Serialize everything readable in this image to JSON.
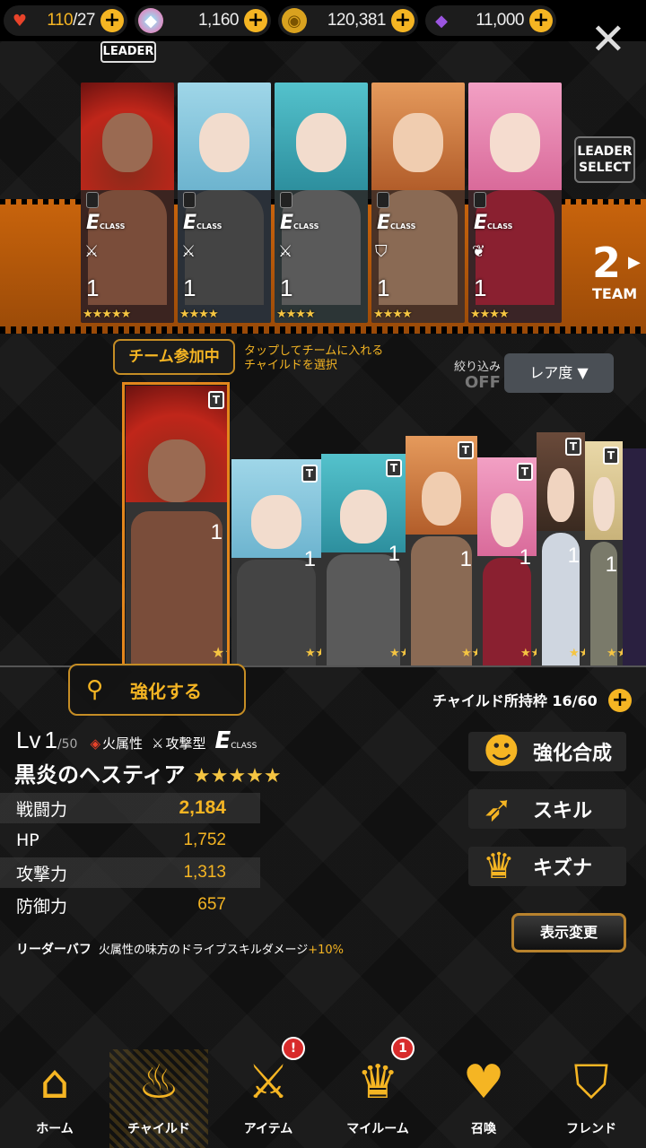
{
  "resources": [
    {
      "icon": "heart-icon",
      "value_hl": "110",
      "value": "/27"
    },
    {
      "icon": "crystal-icon",
      "value_hl": "",
      "value": "1,160"
    },
    {
      "icon": "coin-icon",
      "value_hl": "",
      "value": "120,381"
    },
    {
      "icon": "gem-icon",
      "value_hl": "",
      "value": "11,000"
    }
  ],
  "team": {
    "leader_tag": "LEADER",
    "leader_select": "LEADER SELECT",
    "number": "2",
    "label": "TEAM",
    "members": [
      {
        "class": "E",
        "class_sub": "CLASS",
        "level": "1",
        "stars": "★★★★★"
      },
      {
        "class": "E",
        "class_sub": "CLASS",
        "level": "1",
        "stars": "★★★★"
      },
      {
        "class": "E",
        "class_sub": "CLASS",
        "level": "1",
        "stars": "★★★★"
      },
      {
        "class": "E",
        "class_sub": "CLASS",
        "level": "1",
        "stars": "★★★★"
      },
      {
        "class": "E",
        "class_sub": "CLASS",
        "level": "1",
        "stars": "★★★★"
      }
    ]
  },
  "joined_label": "チーム参加中",
  "hint": [
    "タップしてチームに入れる",
    "チャイルドを選択"
  ],
  "filter": {
    "label": "絞り込み",
    "value": "OFF",
    "sort": "レア度 ▼"
  },
  "roster": [
    {
      "tag": "T",
      "level": "1"
    },
    {
      "tag": "T",
      "level": "1"
    },
    {
      "tag": "T",
      "level": "1"
    },
    {
      "tag": "T",
      "level": "1"
    },
    {
      "tag": "T",
      "level": "1"
    },
    {
      "tag": "T",
      "level": "1"
    },
    {
      "tag": "T",
      "level": "1"
    }
  ],
  "enhance_label": "強化する",
  "slots": "チャイルド所持枠 16/60",
  "detail": {
    "lv_prefix": "Lv",
    "lv": "1",
    "lv_max": "/50",
    "attribute": "火属性",
    "type": "攻撃型",
    "class": "E",
    "class_sub": "CLASS",
    "name": "黒炎のヘスティア",
    "stars": "★★★★★",
    "stats": [
      {
        "label": "戦闘力",
        "value": "2,184"
      },
      {
        "label": "HP",
        "value": "1,752"
      },
      {
        "label": "攻撃力",
        "value": "1,313"
      },
      {
        "label": "防御力",
        "value": "657"
      }
    ],
    "buff_label": "リーダーバフ",
    "buff_text": "火属性の味方のドライブスキルダメージ",
    "buff_pct": "+10%"
  },
  "actions": [
    {
      "icon": "person-lv-icon",
      "label": "強化合成"
    },
    {
      "icon": "skill-icon",
      "label": "スキル"
    },
    {
      "icon": "bond-icon",
      "label": "キズナ"
    }
  ],
  "display_change": "表示変更",
  "nav": [
    {
      "icon": "home-icon",
      "label": "ホーム",
      "badge": ""
    },
    {
      "icon": "child-icon",
      "label": "チャイルド",
      "badge": ""
    },
    {
      "icon": "item-icon",
      "label": "アイテム",
      "badge": "!"
    },
    {
      "icon": "myroom-icon",
      "label": "マイルーム",
      "badge": "1"
    },
    {
      "icon": "summon-icon",
      "label": "召喚",
      "badge": ""
    },
    {
      "icon": "friend-icon",
      "label": "フレンド",
      "badge": ""
    }
  ]
}
